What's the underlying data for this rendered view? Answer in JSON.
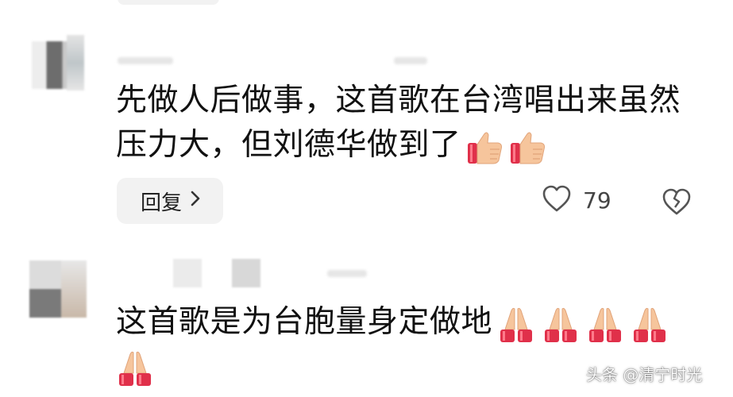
{
  "comments": [
    {
      "text_line1": "先做人后做事，这首歌在台湾唱出来虽然",
      "text_line2": "压力大，但刘德华做到了",
      "emojis": [
        "thumbs-up",
        "thumbs-up"
      ],
      "reply_label": "回复",
      "like_count": "79"
    },
    {
      "text_line1": "这首歌是为台胞量身定做地",
      "emojis": [
        "folded-hands",
        "folded-hands",
        "folded-hands",
        "folded-hands",
        "folded-hands"
      ]
    }
  ],
  "watermark": "头条 @清宁时光",
  "icons": {
    "reply_chevron": "chevron-right-icon",
    "like": "heart-icon",
    "dislike": "broken-heart-icon"
  },
  "colors": {
    "reply_bg": "#f2f2f2",
    "icon": "#555555",
    "thumb_skin": "#f6c59c",
    "cuff": "#e0304a"
  }
}
